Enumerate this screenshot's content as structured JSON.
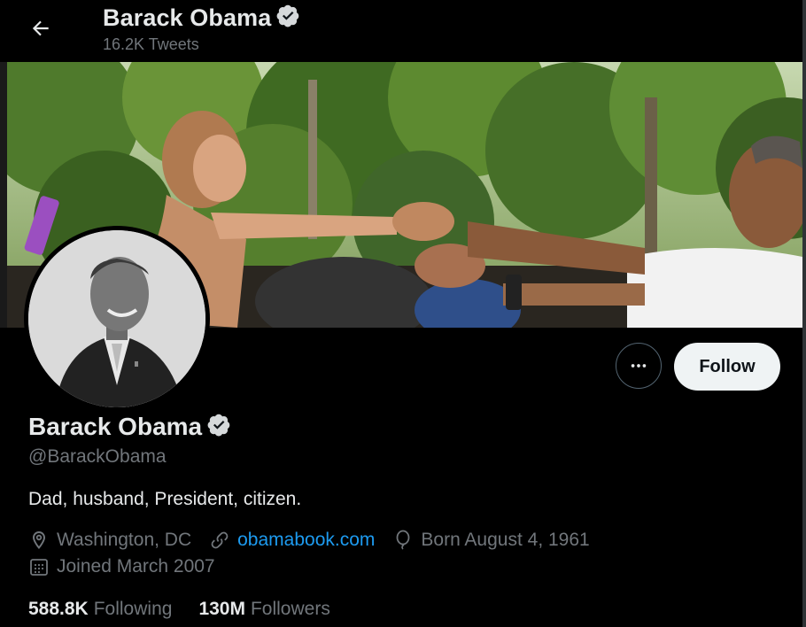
{
  "header": {
    "name": "Barack Obama",
    "tweet_count": "16.2K Tweets"
  },
  "profile": {
    "name": "Barack Obama",
    "handle": "@BarackObama",
    "bio": "Dad, husband, President, citizen.",
    "location": "Washington, DC",
    "website": "obamabook.com",
    "birthday": "Born August 4, 1961",
    "joined": "Joined March 2007"
  },
  "actions": {
    "follow_label": "Follow"
  },
  "stats": {
    "following_count": "588.8K",
    "following_label": "Following",
    "followers_count": "130M",
    "followers_label": "Followers"
  },
  "colors": {
    "background": "#000000",
    "accent_link": "#1d9bf0",
    "secondary_text": "#71767b",
    "primary_text": "#e7e9ea",
    "follow_button_bg": "#eff3f4"
  },
  "icons": {
    "back": "arrow-left-icon",
    "verified": "verified-badge-icon",
    "more": "more-horizontal-icon",
    "location": "location-pin-icon",
    "link": "link-icon",
    "birthday": "balloon-icon",
    "joined": "calendar-icon"
  }
}
